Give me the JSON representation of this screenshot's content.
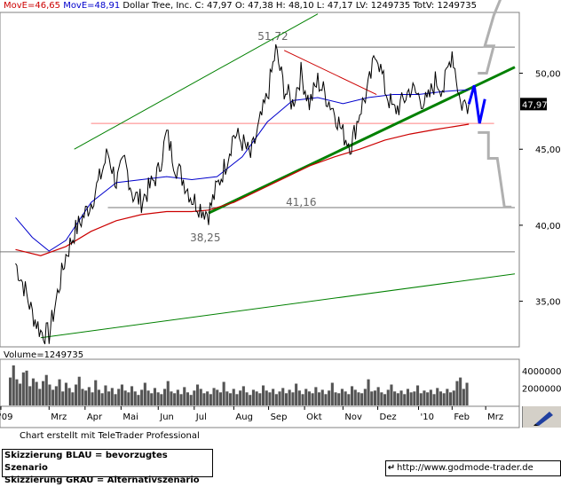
{
  "header": {
    "ma_short": "MovE=46,65",
    "ma_long": "MovE=48,91",
    "info": "Dollar Tree, Inc. C: 47,97 O: 47,38 H: 48,10 L: 47,17 LV: 1249735 TotV: 1249735"
  },
  "volume_label": "Volume=1249735",
  "credit": "Chart erstellt mit TeleTrader Professional",
  "legend": {
    "blue": "Skizzierung BLAU = bevorzugtes Szenario",
    "grey": "Skizzierung GRAU = Alternativszenario"
  },
  "url": "http://www.godmode-trader.de",
  "colors": {
    "price": "#000000",
    "ma_short": "#cc0000",
    "ma_long": "#0000cc",
    "trend_green": "#008000",
    "scenario_blue": "#0000ff",
    "scenario_grey": "#b0b0b0",
    "resistance_pink": "#ff8080",
    "support_gray": "#777777"
  },
  "chart_data": {
    "type": "line",
    "ylim": [
      32.0,
      54.0
    ],
    "yticks": [
      "50,00",
      "45,00",
      "40,00",
      "35,00"
    ],
    "ytick_values": [
      50,
      45,
      40,
      35
    ],
    "last_price_label": "47,97",
    "last_price": 47.97,
    "x_ticks": [
      "'09",
      "Mrz",
      "Apr",
      "Mai",
      "Jun",
      "Jul",
      "Aug",
      "Sep",
      "Okt",
      "Nov",
      "Dez",
      "'10",
      "Feb",
      "Mrz"
    ],
    "horizontal_levels": [
      {
        "label": "51,72",
        "value": 51.72
      },
      {
        "label": "41,16",
        "value": 41.16
      },
      {
        "label": "38,25",
        "value": 38.25
      },
      {
        "label": "",
        "value": 46.7
      }
    ],
    "price_series": [
      [
        "2009-02-02",
        37.5
      ],
      [
        "2009-02-09",
        36.0
      ],
      [
        "2009-02-16",
        34.2
      ],
      [
        "2009-02-23",
        33.0
      ],
      [
        "2009-03-02",
        32.8
      ],
      [
        "2009-03-09",
        35.5
      ],
      [
        "2009-03-16",
        38.0
      ],
      [
        "2009-03-23",
        39.5
      ],
      [
        "2009-03-30",
        40.5
      ],
      [
        "2009-04-06",
        41.5
      ],
      [
        "2009-04-13",
        43.0
      ],
      [
        "2009-04-20",
        44.8
      ],
      [
        "2009-04-27",
        42.8
      ],
      [
        "2009-05-04",
        44.2
      ],
      [
        "2009-05-11",
        42.0
      ],
      [
        "2009-05-18",
        41.6
      ],
      [
        "2009-05-25",
        42.5
      ],
      [
        "2009-06-01",
        43.5
      ],
      [
        "2009-06-08",
        46.0
      ],
      [
        "2009-06-15",
        44.0
      ],
      [
        "2009-06-22",
        43.0
      ],
      [
        "2009-06-29",
        41.8
      ],
      [
        "2009-07-06",
        41.2
      ],
      [
        "2009-07-13",
        40.8
      ],
      [
        "2009-07-20",
        42.5
      ],
      [
        "2009-07-27",
        44.0
      ],
      [
        "2009-08-03",
        46.0
      ],
      [
        "2009-08-10",
        45.5
      ],
      [
        "2009-08-17",
        44.5
      ],
      [
        "2009-08-24",
        46.5
      ],
      [
        "2009-08-31",
        48.5
      ],
      [
        "2009-09-07",
        51.5
      ],
      [
        "2009-09-14",
        49.0
      ],
      [
        "2009-09-21",
        48.0
      ],
      [
        "2009-09-28",
        50.0
      ],
      [
        "2009-10-05",
        48.0
      ],
      [
        "2009-10-12",
        49.5
      ],
      [
        "2009-10-19",
        48.5
      ],
      [
        "2009-10-26",
        47.5
      ],
      [
        "2009-11-02",
        46.0
      ],
      [
        "2009-11-09",
        45.3
      ],
      [
        "2009-11-16",
        47.5
      ],
      [
        "2009-11-23",
        49.0
      ],
      [
        "2009-11-30",
        51.5
      ],
      [
        "2009-12-07",
        49.0
      ],
      [
        "2009-12-14",
        47.5
      ],
      [
        "2009-12-21",
        48.0
      ],
      [
        "2009-12-28",
        49.0
      ],
      [
        "2010-01-04",
        48.5
      ],
      [
        "2010-01-11",
        48.0
      ],
      [
        "2010-01-18",
        49.5
      ],
      [
        "2010-01-25",
        49.0
      ],
      [
        "2010-02-01",
        51.5
      ],
      [
        "2010-02-08",
        48.0
      ],
      [
        "2010-02-15",
        47.97
      ]
    ],
    "ma_short_series": [
      [
        "2009-02-02",
        38.4
      ],
      [
        "2009-02-23",
        38.0
      ],
      [
        "2009-03-16",
        38.6
      ],
      [
        "2009-04-06",
        39.6
      ],
      [
        "2009-04-27",
        40.3
      ],
      [
        "2009-05-18",
        40.7
      ],
      [
        "2009-06-08",
        40.9
      ],
      [
        "2009-06-29",
        40.9
      ],
      [
        "2009-07-13",
        41.0
      ],
      [
        "2009-08-03",
        41.5
      ],
      [
        "2009-08-24",
        42.3
      ],
      [
        "2009-09-14",
        43.1
      ],
      [
        "2009-10-05",
        43.9
      ],
      [
        "2009-10-26",
        44.5
      ],
      [
        "2009-11-16",
        45.0
      ],
      [
        "2009-12-07",
        45.6
      ],
      [
        "2009-12-28",
        46.0
      ],
      [
        "2010-01-18",
        46.3
      ],
      [
        "2010-02-15",
        46.65
      ]
    ],
    "ma_long_series": [
      [
        "2009-02-02",
        40.5
      ],
      [
        "2009-02-16",
        39.2
      ],
      [
        "2009-03-02",
        38.3
      ],
      [
        "2009-03-16",
        39.0
      ],
      [
        "2009-04-06",
        41.5
      ],
      [
        "2009-04-27",
        42.8
      ],
      [
        "2009-05-18",
        43.0
      ],
      [
        "2009-06-08",
        43.2
      ],
      [
        "2009-06-29",
        43.0
      ],
      [
        "2009-07-20",
        43.2
      ],
      [
        "2009-08-10",
        44.5
      ],
      [
        "2009-08-31",
        46.8
      ],
      [
        "2009-09-21",
        48.2
      ],
      [
        "2009-10-12",
        48.4
      ],
      [
        "2009-11-02",
        48.0
      ],
      [
        "2009-11-23",
        48.4
      ],
      [
        "2009-12-14",
        48.6
      ],
      [
        "2010-01-04",
        48.6
      ],
      [
        "2010-01-25",
        48.8
      ],
      [
        "2010-02-15",
        48.91
      ]
    ],
    "volume": {
      "ylabels": [
        "4000000",
        "2000000"
      ],
      "ytick_values": [
        4000000,
        2000000
      ],
      "max": 5000000,
      "bars": [
        3.2,
        4.6,
        3.0,
        2.5,
        3.8,
        4.0,
        2.2,
        3.1,
        2.7,
        1.9,
        2.8,
        3.5,
        2.4,
        1.8,
        2.2,
        3.0,
        1.6,
        2.6,
        2.0,
        1.5,
        2.4,
        3.3,
        1.9,
        1.7,
        2.1,
        1.5,
        2.9,
        1.8,
        1.4,
        2.3,
        1.6,
        2.0,
        1.3,
        1.9,
        2.4,
        1.7,
        1.5,
        2.2,
        1.6,
        1.2,
        1.8,
        2.6,
        1.7,
        1.4,
        2.0,
        1.5,
        1.3,
        1.9,
        2.8,
        1.6,
        1.4,
        1.8,
        1.3,
        2.1,
        1.5,
        1.2,
        1.7,
        2.4,
        1.9,
        1.4,
        1.6,
        1.3,
        2.0,
        1.8,
        1.5,
        2.7,
        1.6,
        1.4,
        1.9,
        1.3,
        1.7,
        2.2,
        1.5,
        1.2,
        1.8,
        1.6,
        1.4,
        2.3,
        1.7,
        1.5,
        1.9,
        1.3,
        1.6,
        2.0,
        1.4,
        1.8,
        1.5,
        2.5,
        1.7,
        1.3,
        1.9,
        1.6,
        1.4,
        2.1,
        1.5,
        1.8,
        1.3,
        1.7,
        2.6,
        1.5,
        1.4,
        1.9,
        1.6,
        1.3,
        2.2,
        1.8,
        1.5,
        1.4,
        1.9,
        3.0,
        1.6,
        1.7,
        2.1,
        1.5,
        1.3,
        1.8,
        2.4,
        1.6,
        1.4,
        1.7,
        1.3,
        1.9,
        1.5,
        1.6,
        2.3,
        1.4,
        1.7,
        1.5,
        1.8,
        1.3,
        2.0,
        1.6,
        1.4,
        1.9,
        1.5,
        1.7,
        2.8,
        3.2,
        1.9,
        2.6
      ]
    }
  }
}
